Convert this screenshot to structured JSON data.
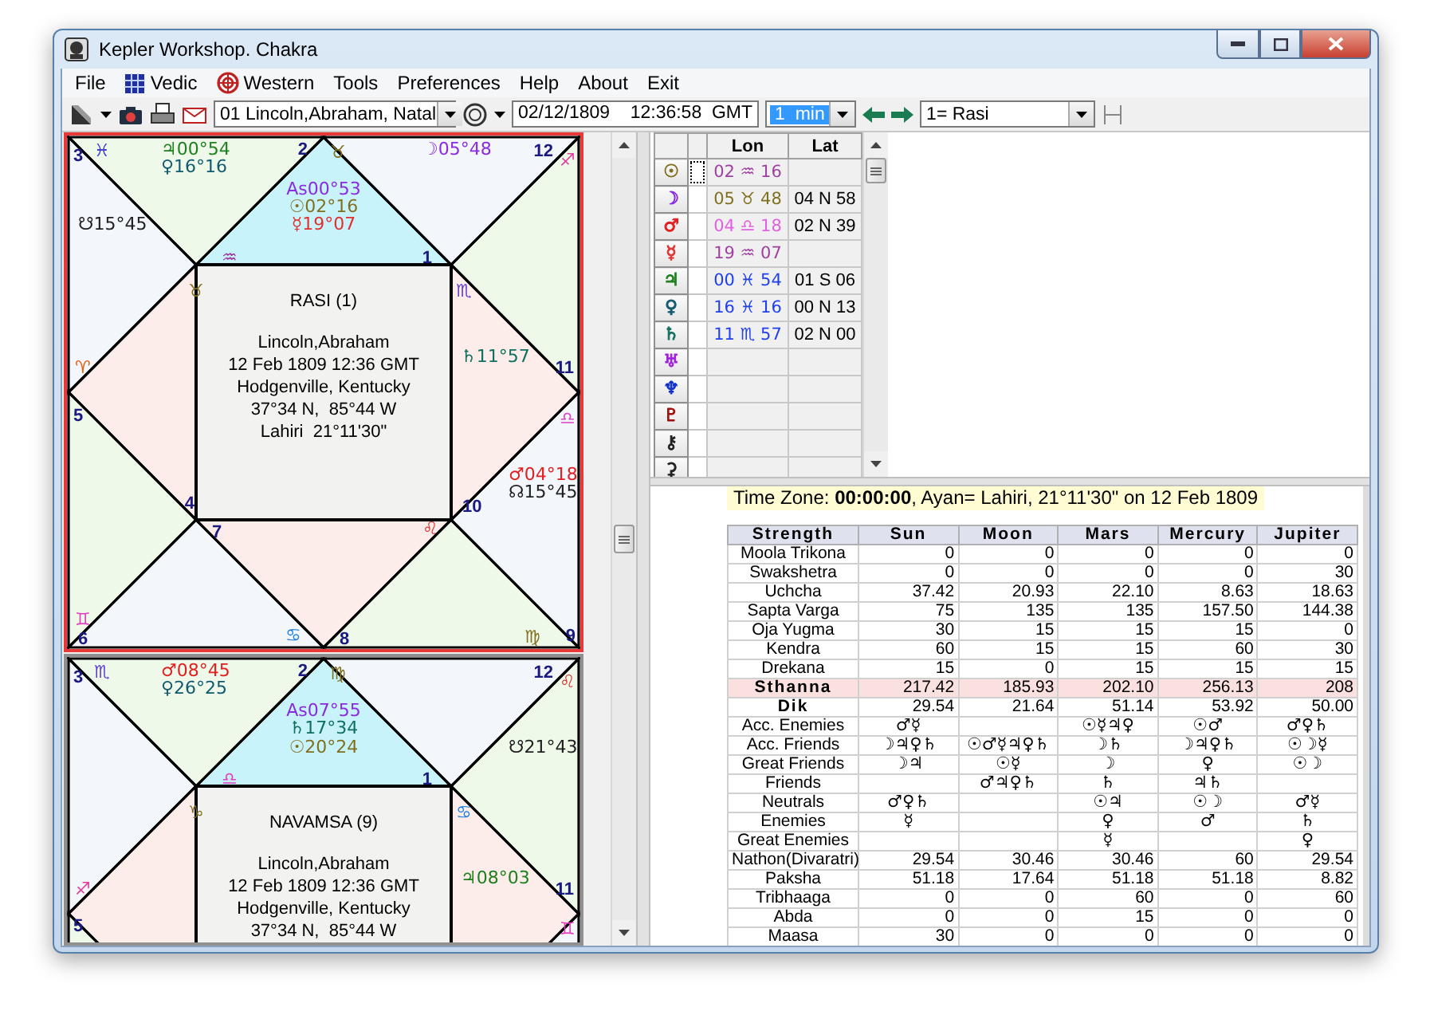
{
  "window": {
    "title": "Kepler Workshop. Chakra"
  },
  "menu": [
    {
      "label": "File",
      "kind": "plain"
    },
    {
      "label": "Vedic",
      "kind": "grid"
    },
    {
      "label": "Western",
      "kind": "wheel"
    },
    {
      "label": "Tools",
      "kind": "plain"
    },
    {
      "label": "Preferences",
      "kind": "plain"
    },
    {
      "label": "Help",
      "kind": "plain"
    },
    {
      "label": "About",
      "kind": "plain"
    },
    {
      "label": "Exit",
      "kind": "plain"
    }
  ],
  "toolbar": {
    "chart_select": "01 Lincoln,Abraham, Natal",
    "datetime": "02/12/1809    12:36:58  GMT",
    "step": "1  min",
    "division": "1= Rasi"
  },
  "charts": [
    {
      "title": "RASI (1)",
      "selected": true,
      "details": [
        "Lincoln,Abraham",
        "12 Feb 1809 12:36 GMT",
        "Hodgenville, Kentucky",
        "37°34 N,  85°44 W",
        "Lahiri  21°11'30\""
      ],
      "house_numbers": [
        "3",
        "2",
        "12",
        "1",
        "11",
        "5",
        "4",
        "10",
        "7",
        "6",
        "8",
        "9"
      ],
      "signs": [
        {
          "glyph": "♓",
          "color": "#4040d0"
        },
        {
          "glyph": "♉",
          "color": "#807020"
        },
        {
          "glyph": "♐",
          "color": "#e040a0"
        },
        {
          "glyph": "♒",
          "color": "#a030a0"
        },
        {
          "glyph": "♉",
          "color": "#807020"
        },
        {
          "glyph": "♏",
          "color": "#6040d0"
        },
        {
          "glyph": "♈",
          "color": "#e06010"
        },
        {
          "glyph": "♎",
          "color": "#e040c0"
        },
        {
          "glyph": "♌",
          "color": "#e03030"
        },
        {
          "glyph": "♊",
          "color": "#e040c0"
        },
        {
          "glyph": "♋",
          "color": "#2080e0"
        },
        {
          "glyph": "♍",
          "color": "#807020"
        }
      ],
      "placements": [
        {
          "text": "♃00°54",
          "color": "#208020"
        },
        {
          "text": "☽05°48",
          "color": "#8a2be2"
        },
        {
          "text": "♀16°16",
          "color": "#105a70"
        },
        {
          "text": "As00°53",
          "color": "#8a2be2"
        },
        {
          "text": "☉02°16",
          "color": "#807020"
        },
        {
          "text": "☋15°45",
          "color": "#202020"
        },
        {
          "text": "☿19°07",
          "color": "#e03030"
        },
        {
          "text": "♄11°57",
          "color": "#107060"
        },
        {
          "text": "♂04°18",
          "color": "#e02020"
        },
        {
          "text": "☊15°45",
          "color": "#202020"
        }
      ]
    },
    {
      "title": "NAVAMSA (9)",
      "selected": false,
      "details": [
        "Lincoln,Abraham",
        "12 Feb 1809 12:36 GMT",
        "Hodgenville, Kentucky",
        "37°34 N,  85°44 W"
      ],
      "house_numbers": [
        "3",
        "2",
        "12",
        "1",
        "11",
        "5"
      ],
      "signs": [
        {
          "glyph": "♏",
          "color": "#6040d0"
        },
        {
          "glyph": "♍",
          "color": "#807020"
        },
        {
          "glyph": "♌",
          "color": "#e03030"
        },
        {
          "glyph": "♎",
          "color": "#e040c0"
        },
        {
          "glyph": "♑",
          "color": "#807020"
        },
        {
          "glyph": "♋",
          "color": "#2080e0"
        },
        {
          "glyph": "♐",
          "color": "#e040a0"
        },
        {
          "glyph": "♊",
          "color": "#e040c0"
        }
      ],
      "placements": [
        {
          "text": "♂08°45",
          "color": "#e02020"
        },
        {
          "text": "♀26°25",
          "color": "#105a70"
        },
        {
          "text": "As07°55",
          "color": "#8a2be2"
        },
        {
          "text": "♄17°34",
          "color": "#107060"
        },
        {
          "text": "☉20°24",
          "color": "#807020"
        },
        {
          "text": "☋21°43",
          "color": "#202020"
        },
        {
          "text": "♃08°03",
          "color": "#208020"
        }
      ]
    }
  ],
  "positions": {
    "columns": [
      "Lon",
      "Lat"
    ],
    "rows": [
      {
        "planet": "☉",
        "color": "#807020",
        "lon": {
          "text": "02 ♒ 16",
          "color": "#a040a0"
        },
        "selected": true
      },
      {
        "planet": "☽",
        "color": "#8a2be2",
        "lon": {
          "text": "05 ♉ 48",
          "color": "#807020"
        },
        "lat": "04 N 58",
        "selected": false
      },
      {
        "planet": "♂",
        "color": "#e02020",
        "lon": {
          "text": "04 ♎ 18",
          "color": "#e060e0"
        },
        "lat": "02 N 39",
        "selected": false
      },
      {
        "planet": "☿",
        "color": "#e03030",
        "lon": {
          "text": "19 ♒ 07",
          "color": "#a040a0"
        },
        "selected": false
      },
      {
        "planet": "♃",
        "color": "#208020",
        "lon": {
          "text": "00 ♓ 54",
          "color": "#2040f0"
        },
        "lat": "01 S 06",
        "selected": false
      },
      {
        "planet": "♀",
        "color": "#105a70",
        "lon": {
          "text": "16 ♓ 16",
          "color": "#2040f0"
        },
        "lat": "00 N 13",
        "selected": false
      },
      {
        "planet": "♄",
        "color": "#107060",
        "lon": {
          "text": "11 ♏ 57",
          "color": "#2040f0"
        },
        "lat": "02 N 00",
        "selected": false
      },
      {
        "planet": "♅",
        "color": "#a020e0",
        "selected": false
      },
      {
        "planet": "♆",
        "color": "#1030d0",
        "selected": false
      },
      {
        "planet": "♇",
        "color": "#a01010",
        "selected": false
      },
      {
        "planet": "⚷",
        "color": "#202020",
        "selected": false
      },
      {
        "planet": "⚳",
        "color": "#202020",
        "selected": false
      }
    ]
  },
  "report": {
    "time_zone": "Time Zone: **00:00:00**, Ayan= Lahiri,  21°11'30\" on 12 Feb 1809",
    "columns": [
      "Strength",
      "Sun",
      "Moon",
      "Mars",
      "Mercury",
      "Jupiter"
    ],
    "rows": [
      {
        "kind": "value",
        "cells": [
          "Moola Trikona",
          "0",
          "0",
          "0",
          "0",
          "0"
        ]
      },
      {
        "kind": "value",
        "cells": [
          "Swakshetra",
          "0",
          "0",
          "0",
          "0",
          "30"
        ]
      },
      {
        "kind": "value",
        "cells": [
          "Uchcha",
          "37.42",
          "20.93",
          "22.10",
          "8.63",
          "18.63"
        ]
      },
      {
        "kind": "value",
        "cells": [
          "Sapta Varga",
          "75",
          "135",
          "135",
          "157.50",
          "144.38"
        ]
      },
      {
        "kind": "value",
        "cells": [
          "Oja Yugma",
          "30",
          "15",
          "15",
          "15",
          "0"
        ]
      },
      {
        "kind": "value",
        "cells": [
          "Kendra",
          "60",
          "15",
          "15",
          "60",
          "30"
        ]
      },
      {
        "kind": "value",
        "cells": [
          "Drekana",
          "15",
          "0",
          "15",
          "15",
          "15"
        ]
      },
      {
        "kind": "total",
        "cells": [
          "Sthanna",
          "217.42",
          "185.93",
          "202.10",
          "256.13",
          "208"
        ]
      },
      {
        "kind": "main",
        "cells": [
          "Dik",
          "29.54",
          "21.64",
          "51.14",
          "53.92",
          "50.00"
        ]
      },
      {
        "kind": "relation",
        "cells": [
          "Acc. Enemies",
          "♂☿",
          "",
          "☉☿♃♀",
          "☉♂",
          "♂♀♄"
        ]
      },
      {
        "kind": "relation",
        "cells": [
          "Acc. Friends",
          "☽♃♀♄",
          "☉♂☿♃♀♄",
          "☽♄",
          "☽♃♀♄",
          "☉☽☿"
        ]
      },
      {
        "kind": "relation",
        "cells": [
          "Great Friends",
          "☽♃",
          "☉☿",
          "☽",
          "♀",
          "☉☽"
        ]
      },
      {
        "kind": "relation",
        "cells": [
          "Friends",
          "",
          "♂♃♀♄",
          "♄",
          "♃♄",
          ""
        ]
      },
      {
        "kind": "relation",
        "cells": [
          "Neutrals",
          "♂♀♄",
          "",
          "☉♃",
          "☉☽",
          "♂☿"
        ]
      },
      {
        "kind": "relation",
        "cells": [
          "Enemies",
          "☿",
          "",
          "♀",
          "♂",
          "♄"
        ]
      },
      {
        "kind": "relation",
        "cells": [
          "Great Enemies",
          "",
          "",
          "☿",
          "",
          "♀"
        ]
      },
      {
        "kind": "value",
        "cells": [
          "Nathon(Divaratri)",
          "29.54",
          "30.46",
          "30.46",
          "60",
          "29.54"
        ]
      },
      {
        "kind": "value",
        "cells": [
          "Paksha",
          "51.18",
          "17.64",
          "51.18",
          "51.18",
          "8.82"
        ]
      },
      {
        "kind": "value",
        "cells": [
          "Tribhaaga",
          "0",
          "0",
          "60",
          "0",
          "60"
        ]
      },
      {
        "kind": "value",
        "cells": [
          "Abda",
          "0",
          "0",
          "15",
          "0",
          "0"
        ]
      },
      {
        "kind": "value",
        "cells": [
          "Maasa",
          "30",
          "0",
          "0",
          "0",
          "0"
        ]
      }
    ]
  }
}
